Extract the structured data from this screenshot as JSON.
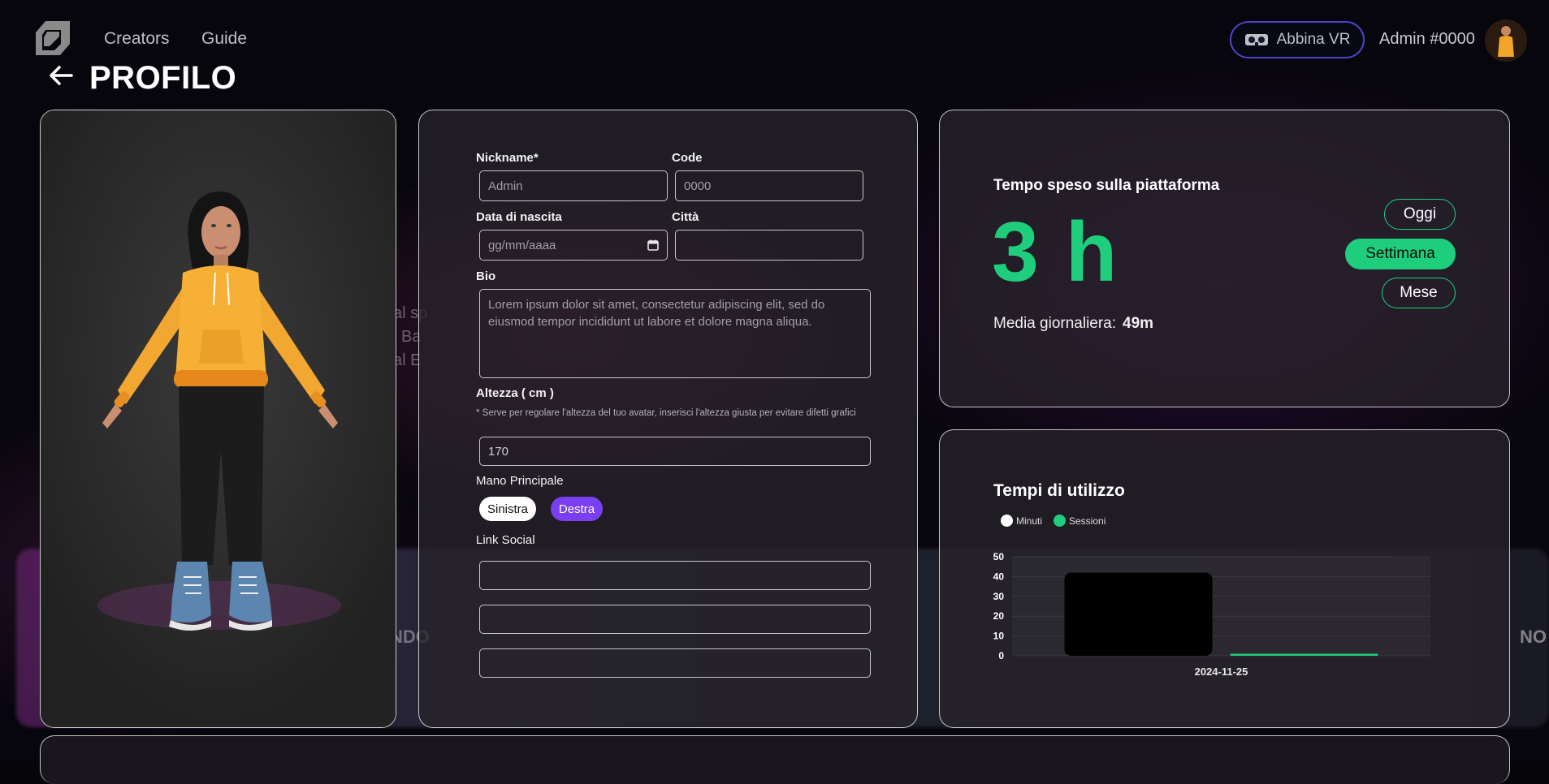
{
  "nav": {
    "links": [
      "Creators",
      "Guide"
    ],
    "vr_button": "Abbina VR",
    "user": "Admin #0000"
  },
  "page": {
    "title": "PROFILO"
  },
  "form": {
    "nickname": {
      "label": "Nickname*",
      "placeholder": "Admin"
    },
    "code": {
      "label": "Code",
      "placeholder": "0000"
    },
    "birth": {
      "label": "Data di nascita",
      "placeholder": "gg/mm/aaaa"
    },
    "city": {
      "label": "Città",
      "value": ""
    },
    "bio": {
      "label": "Bio",
      "placeholder": "Lorem ipsum dolor sit amet, consectetur adipiscing elit, sed do eiusmod tempor incididunt ut labore et dolore magna aliqua."
    },
    "height": {
      "label": "Altezza ( cm )",
      "note": "* Serve per regolare l'altezza del tuo avatar, inserisci l'altezza giusta per evitare difetti grafici",
      "value": "170"
    },
    "hand": {
      "label": "Mano Principale",
      "options": [
        "Sinistra",
        "Destra"
      ],
      "selected": "Destra"
    },
    "social": {
      "label": "Link Social",
      "values": [
        "",
        "",
        ""
      ]
    }
  },
  "time": {
    "title": "Tempo speso sulla piattaforma",
    "value": "3 h",
    "avg_label": "Media giornaliera:",
    "avg_value": "49m",
    "ranges": [
      "Oggi",
      "Settimana",
      "Mese"
    ],
    "selected_range": "Settimana",
    "accent": "#1fce7c"
  },
  "chart_title": "Tempi di utilizzo",
  "chart_data": {
    "type": "bar",
    "categories": [
      "2024-11-25"
    ],
    "series": [
      {
        "name": "Minuti",
        "values": [
          42
        ],
        "color": "#000000"
      },
      {
        "name": "Sessioni",
        "values": [
          1
        ],
        "color": "#1fce7c"
      }
    ],
    "yticks": [
      0,
      10,
      20,
      30,
      40,
      50
    ],
    "ylim": [
      0,
      50
    ],
    "legend": "top-left",
    "grid": true
  },
  "background": {
    "fragments": [
      "al sp",
      "l Ba",
      "al E"
    ],
    "left_word": "NDO",
    "right_word": "NO"
  }
}
